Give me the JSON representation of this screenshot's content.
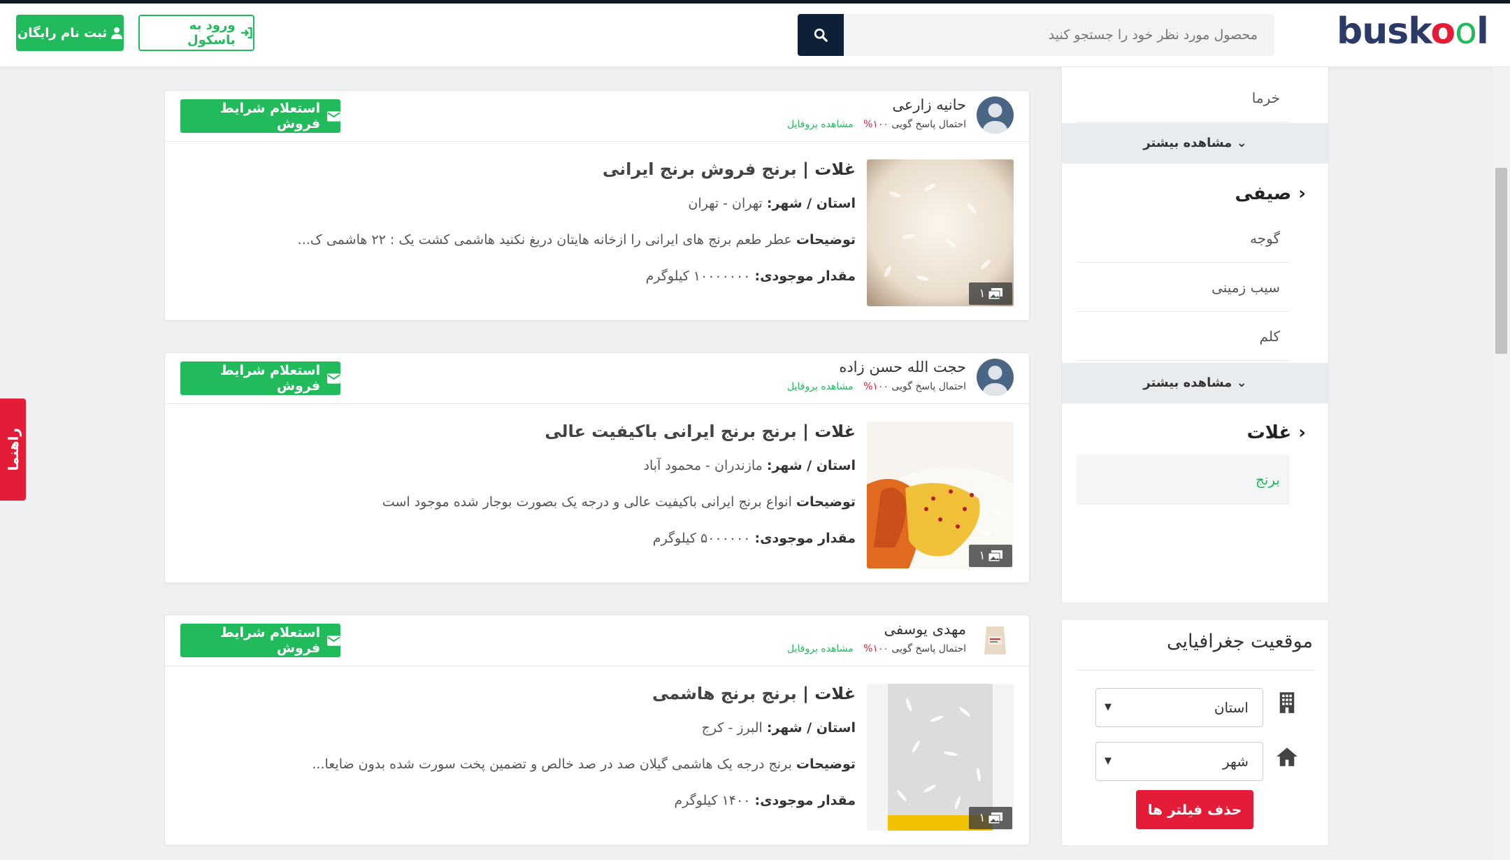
{
  "header": {
    "logo": {
      "p1": "busk",
      "o1": "o",
      "o2": "o",
      "p2": "l"
    },
    "search_placeholder": "محصول مورد نظر خود را جستجو کنید",
    "login_label": "ورود به باسکول",
    "register_label": "ثبت نام رایگان"
  },
  "categories": {
    "top_item": "خرما",
    "more_1": "مشاهده بیشتر",
    "group_1": {
      "title": "صیفی",
      "items": [
        "گوجه",
        "سیب زمینی",
        "کلم"
      ]
    },
    "more_2": "مشاهده بیشتر",
    "group_2": {
      "title": "غلات",
      "items": [
        "برنج"
      ]
    }
  },
  "geo": {
    "title": "موقعیت جغرافیایی",
    "province_placeholder": "استان",
    "city_placeholder": "شهر",
    "clear_label": "حذف فیلتر ها"
  },
  "guide_label": "راهنما",
  "cards": [
    {
      "seller": "حانیه زارعی",
      "response_label": "احتمال پاسخ گویی",
      "response_pct": "۱۰۰%",
      "profile_label": "مشاهده پروفایل",
      "inquiry_label": "استعلام شرایط فروش",
      "category": "غلات |",
      "title": "برنج فروش برنج ایرانی",
      "location_label": "استان / شهر:",
      "location": "تهران - تهران",
      "desc_label": "توضیحات",
      "desc": "عطر طعم برنج های ایرانی را ازخانه هایتان دریغ نکنید هاشمی کشت یک : ۲۲ هاشمی ک...",
      "stock_label": "مقدار موجودی:",
      "stock": "۱۰۰۰۰۰۰۰ کیلوگرم",
      "image_count": "۱"
    },
    {
      "seller": "حجت الله حسن زاده",
      "response_label": "احتمال پاسخ گویی",
      "response_pct": "۱۰۰%",
      "profile_label": "مشاهده پروفایل",
      "inquiry_label": "استعلام شرایط فروش",
      "category": "غلات |",
      "title": "برنج برنج ایرانی باکیفیت عالی",
      "location_label": "استان / شهر:",
      "location": "مازندران - محمود آباد",
      "desc_label": "توضیحات",
      "desc": "انواع برنج ایرانی باکیفیت عالی و درجه یک بصورت بوجار شده موجود است",
      "stock_label": "مقدار موجودی:",
      "stock": "۵۰۰۰۰۰۰ کیلوگرم",
      "image_count": "۱"
    },
    {
      "seller": "مهدی یوسفی",
      "response_label": "احتمال پاسخ گویی",
      "response_pct": "۱۰۰%",
      "profile_label": "مشاهده پروفایل",
      "inquiry_label": "استعلام شرایط فروش",
      "category": "غلات |",
      "title": "برنج برنج هاشمی",
      "location_label": "استان / شهر:",
      "location": "البرز - کرج",
      "desc_label": "توضیحات",
      "desc": "برنج درجه یک هاشمی گیلان صد در صد خالص و تضمین پخت سورت شده بدون ضایعا...",
      "stock_label": "مقدار موجودی:",
      "stock": "۱۴۰۰ کیلوگرم",
      "image_count": "۱"
    }
  ],
  "colors": {
    "brand_green": "#21bb5c",
    "brand_red": "#e41c38",
    "navy": "#101f38"
  }
}
